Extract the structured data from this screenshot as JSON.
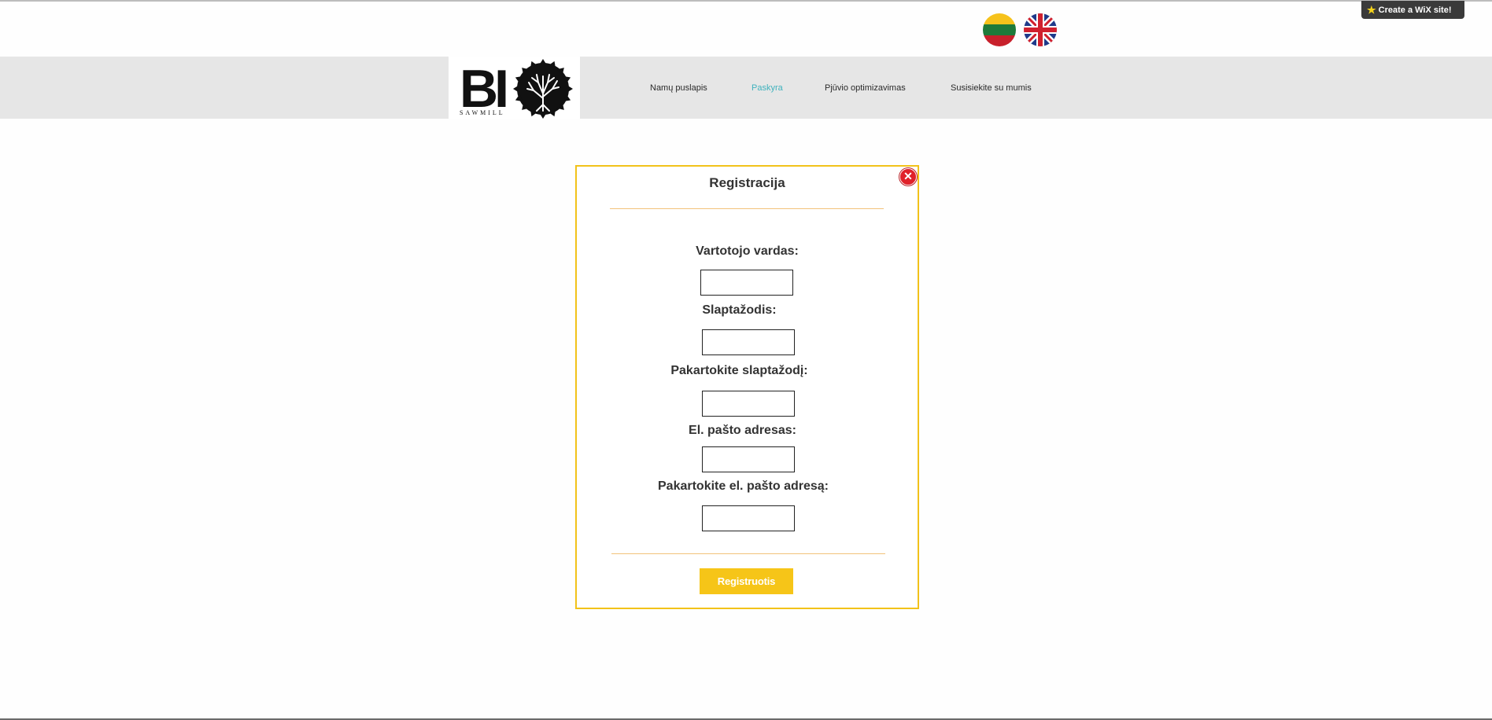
{
  "wix_badge": {
    "label": "Create a WiX site!"
  },
  "languages": [
    {
      "code": "lt",
      "flag": "lithuania-flag"
    },
    {
      "code": "en",
      "flag": "uk-flag"
    }
  ],
  "logo": {
    "main": "BI",
    "sub": "SAWMILL"
  },
  "nav": {
    "items": [
      {
        "label": "Namų puslapis",
        "active": false
      },
      {
        "label": "Paskyra",
        "active": true
      },
      {
        "label": "Pjūvio optimizavimas",
        "active": false
      },
      {
        "label": "Susisiekite su mumis",
        "active": false
      }
    ],
    "active_color": "#3fb2bd"
  },
  "dialog": {
    "title": "Registracija",
    "fields": [
      {
        "label": "Vartotojo vardas:",
        "value": ""
      },
      {
        "label": "Slaptažodis:",
        "value": ""
      },
      {
        "label": "Pakartokite slaptažodį:",
        "value": ""
      },
      {
        "label": "El. pašto adresas:",
        "value": ""
      },
      {
        "label": "Pakartokite el. pašto adresą:",
        "value": ""
      }
    ],
    "submit_label": "Registruotis",
    "accent_color": "#f2c21a"
  }
}
